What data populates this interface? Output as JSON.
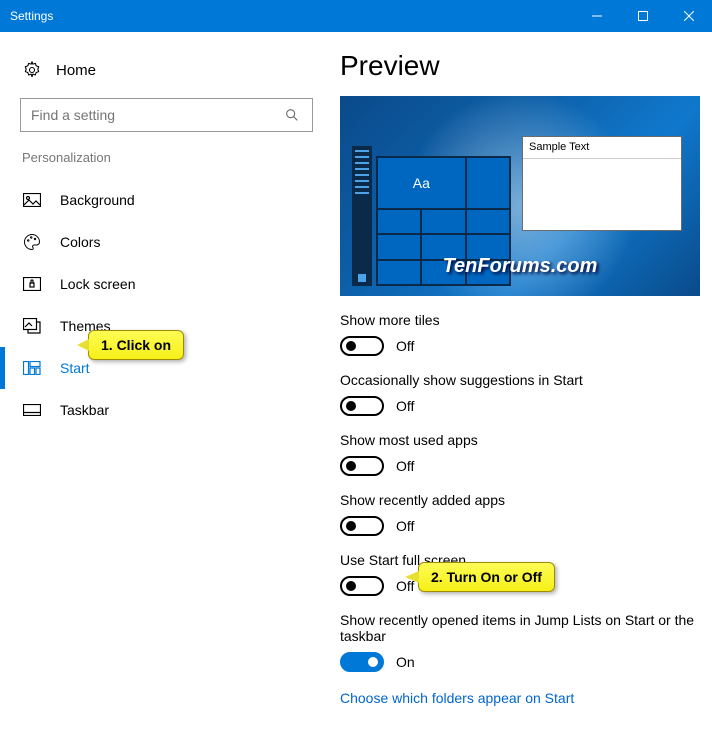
{
  "window": {
    "title": "Settings"
  },
  "sidebar": {
    "home": "Home",
    "search_placeholder": "Find a setting",
    "section": "Personalization",
    "items": [
      {
        "label": "Background"
      },
      {
        "label": "Colors"
      },
      {
        "label": "Lock screen"
      },
      {
        "label": "Themes"
      },
      {
        "label": "Start"
      },
      {
        "label": "Taskbar"
      }
    ]
  },
  "content": {
    "heading": "Preview",
    "sample_text": "Sample Text",
    "tile_aa": "Aa",
    "watermark": "TenForums.com",
    "settings": [
      {
        "label": "Show more tiles",
        "state": "Off",
        "on": false
      },
      {
        "label": "Occasionally show suggestions in Start",
        "state": "Off",
        "on": false
      },
      {
        "label": "Show most used apps",
        "state": "Off",
        "on": false
      },
      {
        "label": "Show recently added apps",
        "state": "Off",
        "on": false
      },
      {
        "label": "Use Start full screen",
        "state": "Off",
        "on": false
      },
      {
        "label": "Show recently opened items in Jump Lists on Start or the taskbar",
        "state": "On",
        "on": true
      }
    ],
    "link": "Choose which folders appear on Start"
  },
  "callouts": {
    "c1": "1. Click on",
    "c2": "2. Turn On or Off"
  }
}
